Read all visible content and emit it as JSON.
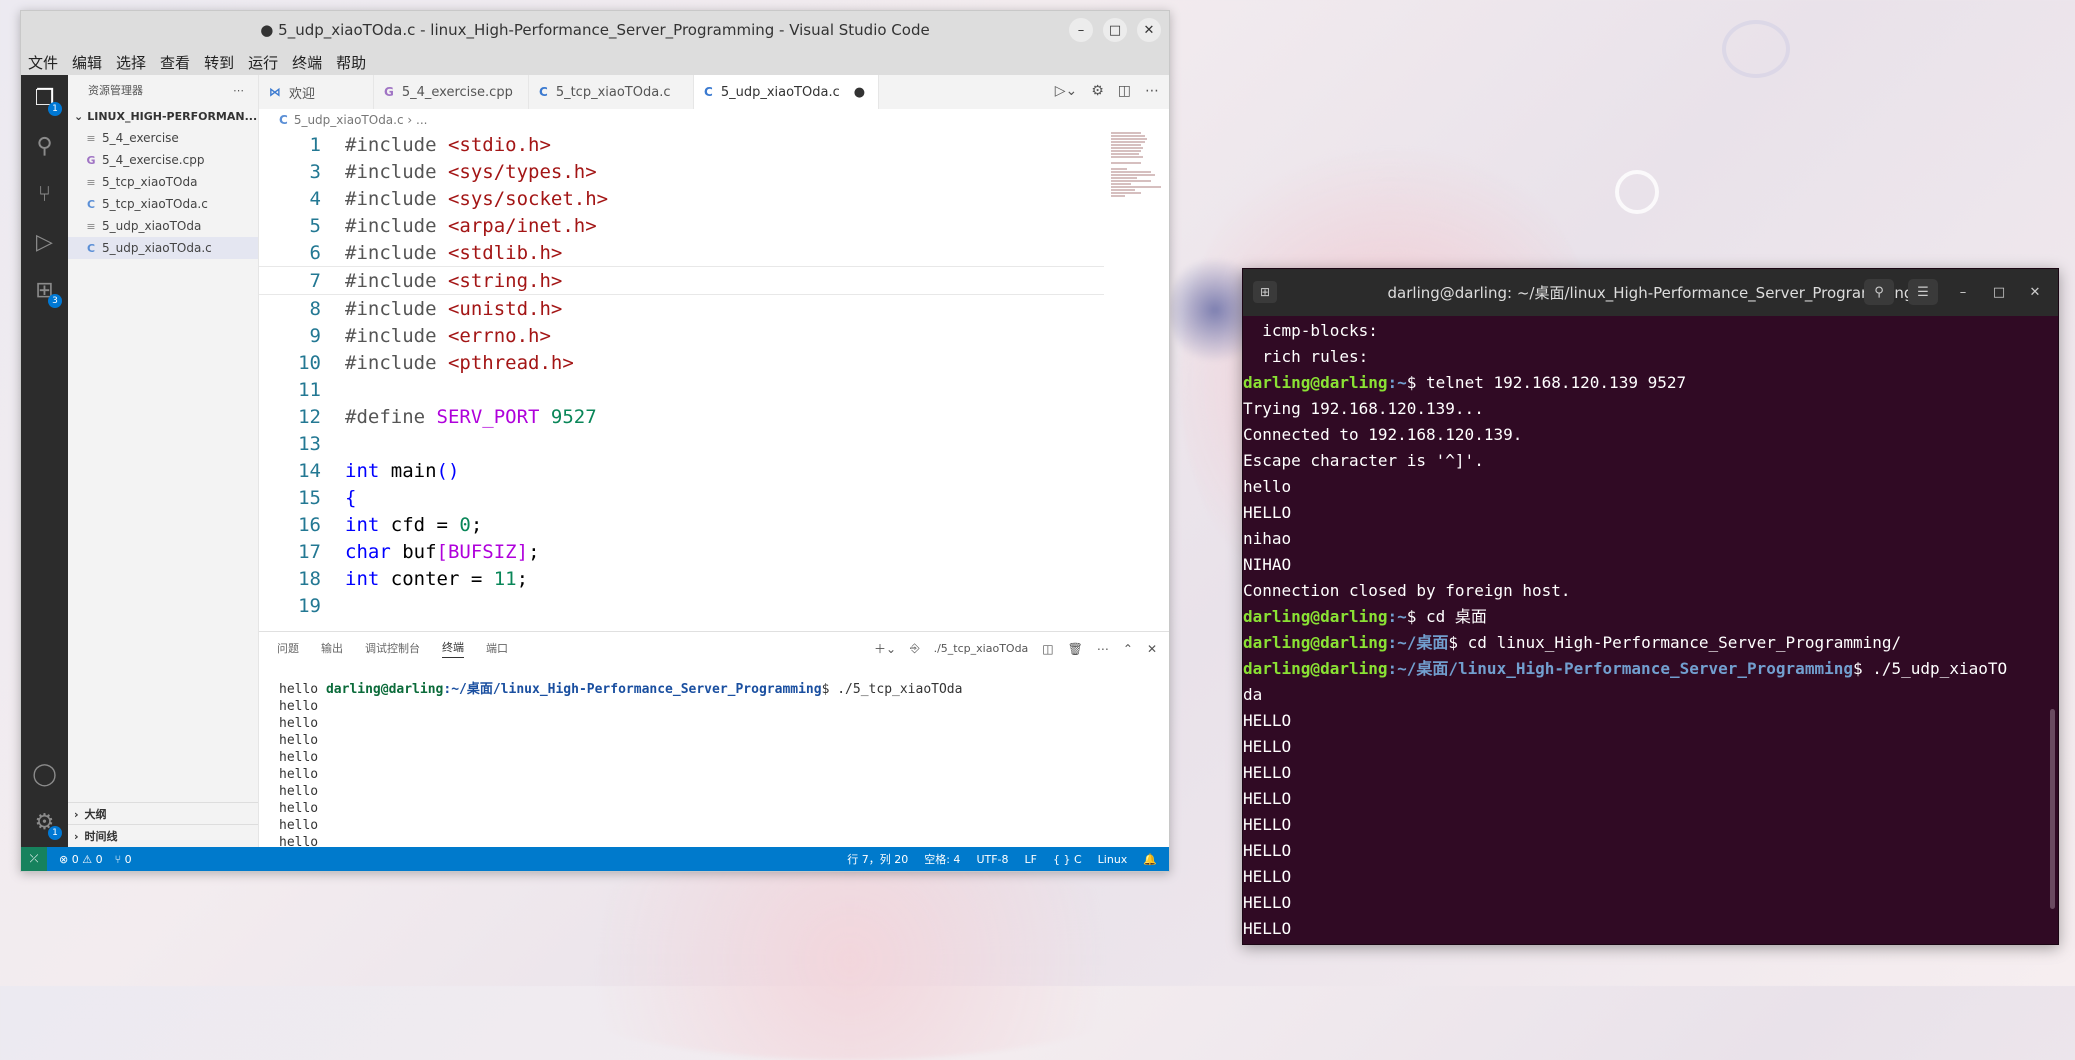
{
  "vscode": {
    "title": "● 5_udp_xiaoTOda.c - linux_High-Performance_Server_Programming - Visual Studio Code",
    "menu": [
      "文件",
      "编辑",
      "选择",
      "查看",
      "转到",
      "运行",
      "终端",
      "帮助"
    ],
    "activity_badges": {
      "explorer": "1",
      "extensions": "3",
      "settings": "1"
    },
    "sidebar": {
      "title": "资源管理器",
      "folder": "LINUX_HIGH-PERFORMAN...",
      "files": [
        "5_4_exercise",
        "5_4_exercise.cpp",
        "5_tcp_xiaoTOda",
        "5_tcp_xiaoTOda.c",
        "5_udp_xiaoTOda",
        "5_udp_xiaoTOda.c"
      ],
      "outline": "大纲",
      "timeline": "时间线"
    },
    "tabs": [
      "欢迎",
      "5_4_exercise.cpp",
      "5_tcp_xiaoTOda.c",
      "5_udp_xiaoTOda.c"
    ],
    "breadcrumb": "5_udp_xiaoTOda.c › ...",
    "code": [
      {
        "n": "1",
        "t": "#include <stdio.h>"
      },
      {
        "n": "3",
        "t": "#include <sys/types.h>"
      },
      {
        "n": "4",
        "t": "#include <sys/socket.h>"
      },
      {
        "n": "5",
        "t": "#include <arpa/inet.h>"
      },
      {
        "n": "6",
        "t": "#include <stdlib.h>"
      },
      {
        "n": "7",
        "t": "#include <string.h>"
      },
      {
        "n": "8",
        "t": "#include <unistd.h>"
      },
      {
        "n": "9",
        "t": "#include <errno.h>"
      },
      {
        "n": "10",
        "t": "#include <pthread.h>"
      },
      {
        "n": "11",
        "t": ""
      },
      {
        "n": "12",
        "t": "#define SERV_PORT 9527"
      },
      {
        "n": "13",
        "t": ""
      },
      {
        "n": "14",
        "t": "int main()"
      },
      {
        "n": "15",
        "t": "{"
      },
      {
        "n": "16",
        "t": "int cfd = 0;"
      },
      {
        "n": "17",
        "t": "char buf[BUFSIZ];"
      },
      {
        "n": "18",
        "t": "int conter = 11;"
      },
      {
        "n": "19",
        "t": ""
      }
    ],
    "panel": {
      "tabs": [
        "问题",
        "输出",
        "调试控制台",
        "终端",
        "端口"
      ],
      "terminal_name": "./5_tcp_xiaoTOda",
      "prompt_user": "darling@darling",
      "prompt_path": "~/桌面/linux_High-Performance_Server_Programming",
      "prompt_cmd": "$ ./5_tcp_xiaoTOda",
      "lines": [
        "hello",
        "hello",
        "hello",
        "hello",
        "hello",
        "hello",
        "hello",
        "hello",
        "hello",
        "hello"
      ]
    },
    "status": {
      "errors": "⊗ 0 ⚠ 0",
      "ports": "⑂ 0",
      "position": "行 7，列 20",
      "spaces": "空格: 4",
      "encoding": "UTF-8",
      "eol": "LF",
      "language": "{ } C",
      "platform": "Linux"
    }
  },
  "terminal": {
    "title": "darling@darling: ~/桌面/linux_High-Performance_Server_Programming",
    "lines": [
      {
        "plain": "  icmp-blocks: "
      },
      {
        "plain": "  rich rules: "
      },
      {
        "user": "darling@darling",
        "path": ":~",
        "rest": "$ telnet 192.168.120.139 9527"
      },
      {
        "plain": "Trying 192.168.120.139..."
      },
      {
        "plain": "Connected to 192.168.120.139."
      },
      {
        "plain": "Escape character is '^]'."
      },
      {
        "plain": "hello"
      },
      {
        "plain": "HELLO"
      },
      {
        "plain": "nihao"
      },
      {
        "plain": "NIHAO"
      },
      {
        "plain": "Connection closed by foreign host."
      },
      {
        "user": "darling@darling",
        "path": ":~",
        "rest": "$ cd 桌面"
      },
      {
        "user": "darling@darling",
        "path": ":~/桌面",
        "rest": "$ cd linux_High-Performance_Server_Programming/"
      },
      {
        "user": "darling@darling",
        "path": ":~/桌面/linux_High-Performance_Server_Programming",
        "rest": "$ ./5_udp_xiaoTO"
      },
      {
        "plain": "da"
      },
      {
        "plain": "HELLO"
      },
      {
        "plain": "HELLO"
      },
      {
        "plain": "HELLO"
      },
      {
        "plain": "HELLO"
      },
      {
        "plain": "HELLO"
      },
      {
        "plain": "HELLO"
      },
      {
        "plain": "HELLO"
      },
      {
        "plain": "HELLO"
      },
      {
        "plain": "HELLO"
      }
    ]
  },
  "colors": {
    "terminal_bg": "#300a24",
    "statusbar": "#007acc",
    "activity_bar": "#2c2c2c"
  }
}
